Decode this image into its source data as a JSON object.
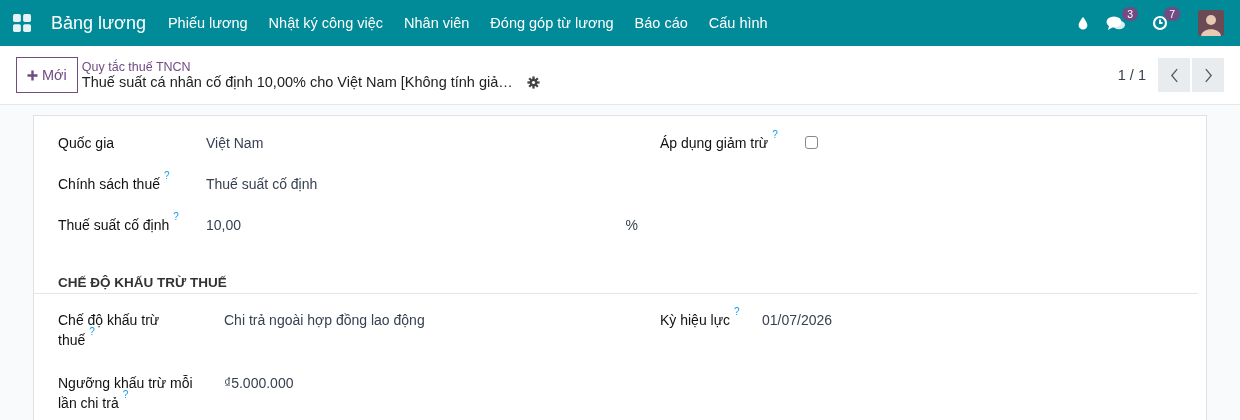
{
  "navbar": {
    "app_name": "Bảng lương",
    "menu": [
      "Phiếu lương",
      "Nhật ký công việc",
      "Nhân viên",
      "Đóng góp từ lương",
      "Báo cáo",
      "Cấu hình"
    ],
    "chat_badge": "3",
    "activity_badge": "7"
  },
  "control_panel": {
    "new_button": "Mới",
    "breadcrumb": "Quy tắc thuế TNCN",
    "record_title": "Thuế suất cá nhân cố định 10,00% cho Việt Nam [Không tính giả…",
    "pager": "1 / 1"
  },
  "form": {
    "left_fields": [
      {
        "kind": "text",
        "label": "Quốc gia",
        "value": "Việt Nam"
      },
      {
        "kind": "text",
        "label": "Chính sách thuế",
        "help": "?",
        "value": "Thuế suất cố định"
      },
      {
        "kind": "text",
        "label": "Thuế suất cố định",
        "help": "?",
        "value": "10,00",
        "unit": "%"
      }
    ],
    "right_fields": [
      {
        "kind": "checkbox",
        "label": "Áp dụng giảm trừ",
        "help": "?",
        "checked": false
      }
    ],
    "sections": [
      {
        "title": "CHẾ ĐỘ KHẤU TRỪ THUẾ",
        "left_fields": [
          {
            "kind": "text",
            "label": "Chế độ khấu trừ thuế",
            "help": "?",
            "value": "Chi trả ngoài hợp đồng lao động"
          },
          {
            "kind": "text",
            "label": "Ngưỡng khấu trừ mỗi lần chi trả",
            "help": "?",
            "value": "₫5.000.000"
          }
        ],
        "right_fields": [
          {
            "kind": "text",
            "label": "Kỳ hiệu lực",
            "help": "?",
            "value": "01/07/2026"
          }
        ]
      }
    ]
  }
}
